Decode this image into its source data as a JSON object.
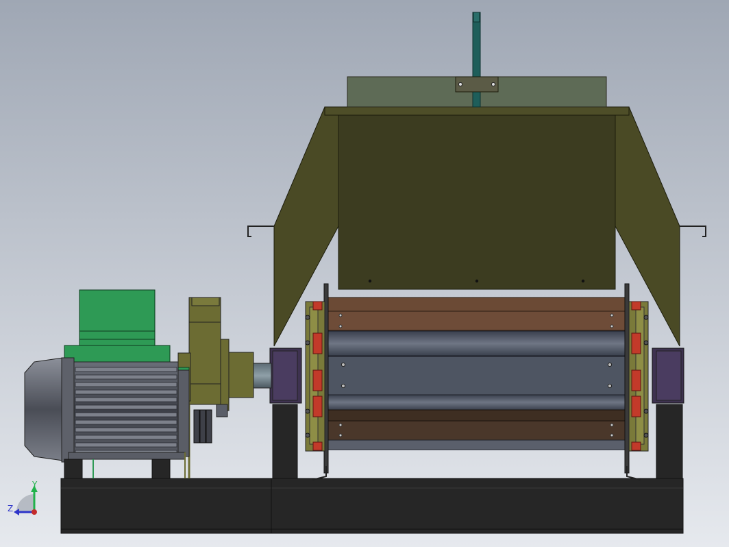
{
  "viewport": {
    "background_top": "#9FA7B4",
    "background_bottom": "#E6E9EE"
  },
  "triad": {
    "y_label": "Y",
    "z_label": "Z",
    "y_color": "#21B24B",
    "z_color": "#2D34C9",
    "origin_color": "#C42B2B"
  },
  "colors": {
    "hopper": "#4A4A25",
    "hopper_front": "#3C3C20",
    "hopper_lid": "#5E6B56",
    "feed_rod": "#1E5E5A",
    "base_frame": "#262626",
    "motor_body": "#4A4D55",
    "motor_fan_cover": "#6A6D76",
    "terminal_box": "#2E9A55",
    "coupling": "#6C6C33",
    "bearing_block": "#3E3250",
    "roller_brown": "#6B4A35",
    "roller_dark_brown": "#3E2E22",
    "roller_steel": "#4E5562",
    "sprocket": "#7A7A3A",
    "tooth_red": "#C23A2A"
  }
}
